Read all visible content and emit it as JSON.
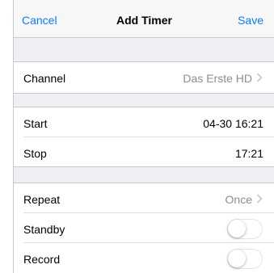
{
  "navbar": {
    "cancel_label": "Cancel",
    "title": "Add Timer",
    "save_label": "Save"
  },
  "channel": {
    "label": "Channel",
    "value": "Das Erste HD"
  },
  "time": {
    "start_label": "Start",
    "start_value": "04-30 16:21",
    "stop_label": "Stop",
    "stop_value": "17:21"
  },
  "options": {
    "repeat_label": "Repeat",
    "repeat_value": "Once",
    "standby_label": "Standby",
    "standby_on": false,
    "record_label": "Record",
    "record_on": false
  },
  "colors": {
    "accent": "#0a7cff",
    "secondary_text": "#8e8e93",
    "background": "#efeff4"
  },
  "icons": {
    "disclosure": "chevron-right-icon"
  }
}
